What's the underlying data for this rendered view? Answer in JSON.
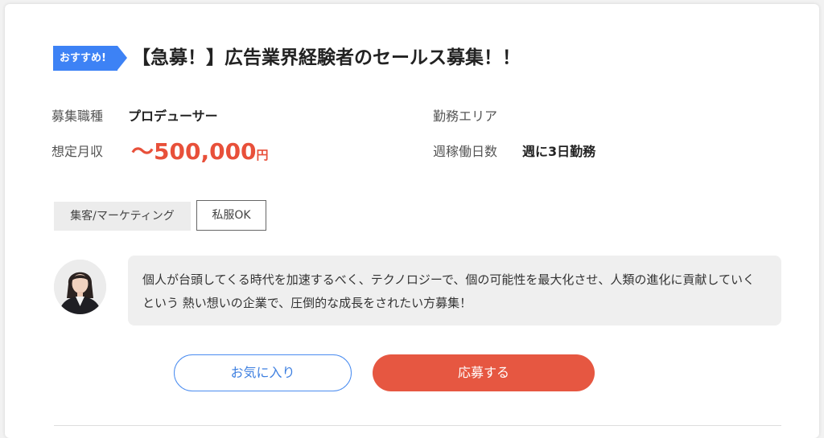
{
  "badge": {
    "label": "おすすめ!",
    "color": "#3d82f5"
  },
  "job": {
    "title": "【急募！】広告業界経験者のセールス募集！！"
  },
  "info": {
    "position_label": "募集職種",
    "position_value": "プロデューサー",
    "salary_label": "想定月収",
    "salary_amount": "～500,000",
    "salary_unit": "円",
    "area_label": "勤務エリア",
    "area_value": "",
    "days_label": "週稼働日数",
    "days_value": "週に3日勤務"
  },
  "tags": [
    {
      "label": "集客/マーケティング",
      "style": "filled"
    },
    {
      "label": "私服OK",
      "style": "outline"
    }
  ],
  "message": {
    "avatar": "person-avatar",
    "text": "個人が台頭してくる時代を加速するべく、テクノロジーで、個の可能性を最大化させ、人類の進化に貢献していくという 熱い想いの企業で、圧倒的な成長をされたい方募集！"
  },
  "buttons": {
    "favorite_label": "お気に入り",
    "apply_label": "応募する",
    "apply_color": "#e65741"
  }
}
